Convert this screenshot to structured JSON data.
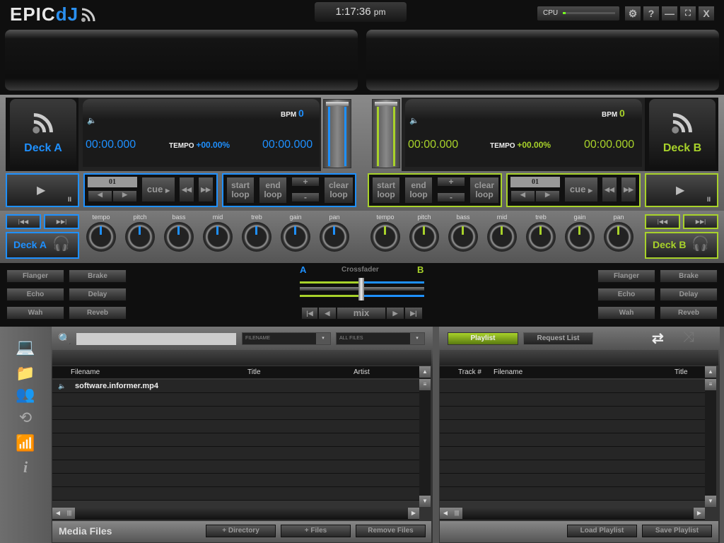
{
  "app": {
    "logo_epic": "EPIC",
    "logo_dj": "dJ",
    "clock": "1:17:36",
    "clock_ampm": "pm",
    "cpu_label": "CPU",
    "cpu_load_percent": 5
  },
  "window_buttons": {
    "settings": "⚙",
    "help": "?",
    "minimize": "—",
    "fullscreen": "⛶",
    "close": "X"
  },
  "colors": {
    "deck_a": "#1e90ff",
    "deck_b": "#a8d22a"
  },
  "deck_a": {
    "name": "Deck A",
    "bpm_label": "BPM",
    "bpm": "0",
    "elapsed": "00:00.000",
    "tempo_label": "TEMPO",
    "tempo": "+00.00%",
    "remaining": "00:00.000",
    "cue_number": "01",
    "cue_label": "cue",
    "start_loop": [
      "start",
      "loop"
    ],
    "end_loop": [
      "end",
      "loop"
    ],
    "clear_loop": [
      "clear",
      "loop"
    ],
    "plus": "+",
    "minus": "-"
  },
  "deck_b": {
    "name": "Deck B",
    "bpm_label": "BPM",
    "bpm": "0",
    "elapsed": "00:00.000",
    "tempo_label": "TEMPO",
    "tempo": "+00.00%",
    "remaining": "00:00.000",
    "cue_number": "01",
    "cue_label": "cue",
    "start_loop": [
      "start",
      "loop"
    ],
    "end_loop": [
      "end",
      "loop"
    ],
    "clear_loop": [
      "clear",
      "loop"
    ],
    "plus": "+",
    "minus": "-"
  },
  "knobs": [
    "tempo",
    "pitch",
    "bass",
    "mid",
    "treb",
    "gain",
    "pan"
  ],
  "effects": [
    [
      "Flanger",
      "Brake"
    ],
    [
      "Echo",
      "Delay"
    ],
    [
      "Wah",
      "Reveb"
    ]
  ],
  "crossfader": {
    "label": "Crossfader",
    "a": "A",
    "b": "B",
    "mix": "mix",
    "position": 0.5
  },
  "media": {
    "search_placeholder": "",
    "filter_field": "FILENAME",
    "filter_type": "ALL FILES",
    "columns": [
      "Filename",
      "Title",
      "Artist"
    ],
    "rows": [
      {
        "filename": "software.informer.mp4",
        "title": "",
        "artist": ""
      }
    ],
    "footer_title": "Media Files",
    "add_directory": "+ Directory",
    "add_files": "+ Files",
    "remove_files": "Remove Files"
  },
  "playlist": {
    "tab_playlist": "Playlist",
    "tab_request": "Request List",
    "columns": [
      "Track #",
      "Filename",
      "Title"
    ],
    "load": "Load Playlist",
    "save": "Save Playlist"
  }
}
